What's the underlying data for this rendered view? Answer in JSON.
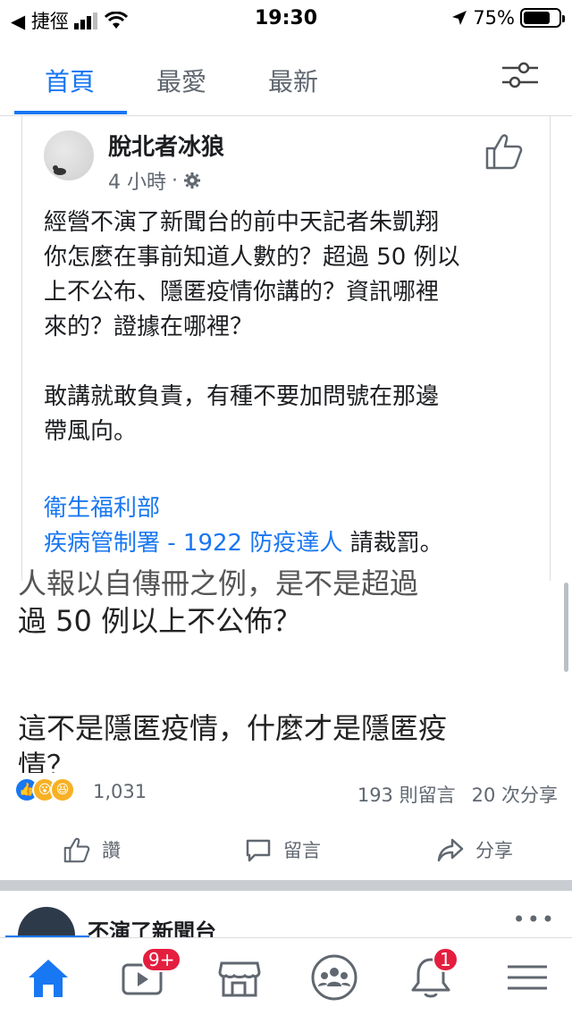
{
  "status_bar": {
    "back_label": "◀ 捷徑",
    "time": "19:30",
    "battery": "75%",
    "battery_level": 0.75
  },
  "top_tabs": [
    {
      "label": "首頁",
      "active": true
    },
    {
      "label": "最愛",
      "active": false
    },
    {
      "label": "最新",
      "active": false
    }
  ],
  "post": {
    "author": "脫北者冰狼",
    "time": "4 小時",
    "separator": "·",
    "paragraphs": [
      "經營不演了新聞台的前中天記者朱凱翔\n你怎麼在事前知道人數的？超過 50 例以\n上不公布、隱匿疫情你講的？資訊哪裡\n來的？證據在哪裡？",
      "敢講就敢負責，有種不要加問號在那邊\n帶風向。"
    ],
    "link_1": "衛生福利部",
    "link_2": "疾病管制署 - 1922 防疫達人",
    "link_2_suffix": " 請裁罰。"
  },
  "shared_image": {
    "line_cut": "人報以自傳冊之例，是不是超過",
    "line_1": "過 50 例以上不公佈？",
    "line_2": "這不是隱匿疫情，什麼才是隱匿疫",
    "line_3": "情？"
  },
  "reactions": {
    "count": "1,031",
    "comments": "193 則留言",
    "shares": "20 次分享",
    "icons": [
      "like-icon",
      "wow-icon",
      "haha-icon"
    ]
  },
  "actions": {
    "like": "讚",
    "comment": "留言",
    "share": "分享"
  },
  "next_post": {
    "author": "不演了新聞台",
    "more": "•••"
  },
  "bottom_nav": {
    "video_badge": "9+",
    "notification_badge": "1",
    "active_color": "#1877f2"
  }
}
